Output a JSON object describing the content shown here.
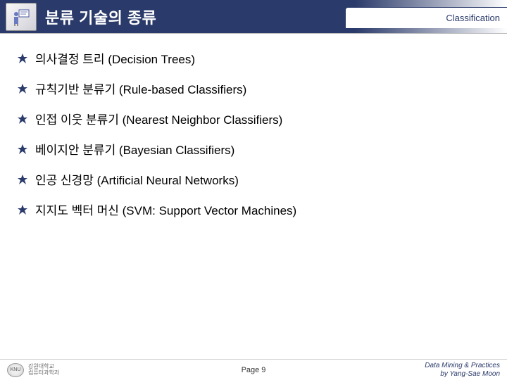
{
  "header": {
    "title": "분류 기술의 종류",
    "tag": "Classification"
  },
  "bullets": [
    {
      "text": "의사결정 트리 (Decision Trees)"
    },
    {
      "text": "규칙기반 분류기 (Rule-based Classifiers)"
    },
    {
      "text": "인접 이웃 분류기 (Nearest Neighbor Classifiers)"
    },
    {
      "text": "베이지안 분류기 (Bayesian Classifiers)"
    },
    {
      "text": "인공 신경망 (Artificial Neural Networks)"
    },
    {
      "text": "지지도 벡터 머신 (SVM: Support Vector Machines)"
    }
  ],
  "footer": {
    "inst_line1": "강원대학교",
    "inst_line2": "컴퓨터과학과",
    "page": "Page 9",
    "credit_line1": "Data Mining & Practices",
    "credit_line2": "by Yang-Sae Moon"
  }
}
